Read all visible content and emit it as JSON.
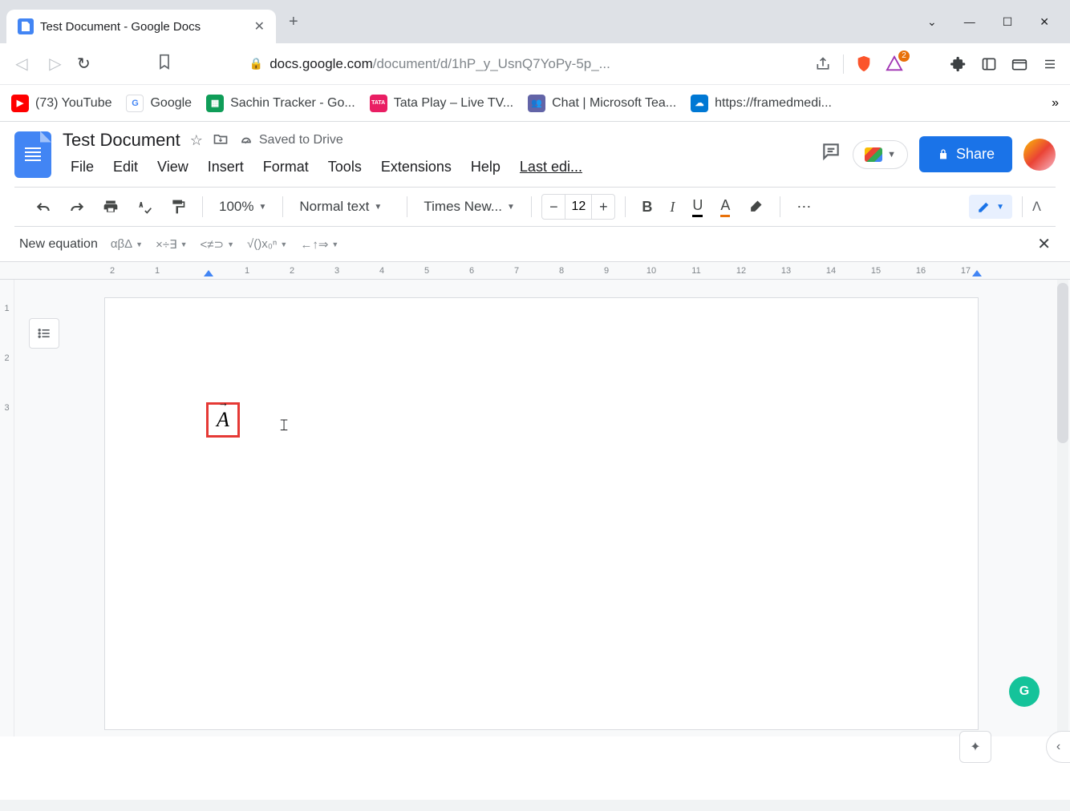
{
  "browser": {
    "tab_title": "Test Document - Google Docs",
    "url_host": "docs.google.com",
    "url_path": "/document/d/1hP_y_UsnQ7YoPy-5p_...",
    "brave_count": "2"
  },
  "bookmarks": [
    {
      "label": "(73) YouTube"
    },
    {
      "label": "Google"
    },
    {
      "label": "Sachin Tracker - Go..."
    },
    {
      "label": "Tata Play – Live TV..."
    },
    {
      "label": "Chat | Microsoft Tea..."
    },
    {
      "label": "https://framedmedi..."
    }
  ],
  "docs": {
    "title": "Test Document",
    "saved": "Saved to Drive",
    "menus": [
      "File",
      "Edit",
      "View",
      "Insert",
      "Format",
      "Tools",
      "Extensions",
      "Help"
    ],
    "last_edit": "Last edi...",
    "share": "Share"
  },
  "toolbar": {
    "zoom": "100%",
    "style": "Normal text",
    "font": "Times New...",
    "font_size": "12"
  },
  "equation_bar": {
    "label": "New equation",
    "groups": [
      "αβΔ",
      "×÷∃",
      "<≠⊃",
      "√()x₀ⁿ",
      "←↑⇒"
    ]
  },
  "ruler_marks": [
    "2",
    "1",
    "",
    "1",
    "2",
    "3",
    "4",
    "5",
    "6",
    "7",
    "8",
    "9",
    "10",
    "11",
    "12",
    "13",
    "14",
    "15",
    "16",
    "17"
  ],
  "vruler_marks": [
    "",
    "",
    "1",
    "",
    "2",
    "",
    "3"
  ],
  "equation_char": "A",
  "grammarly": "G"
}
